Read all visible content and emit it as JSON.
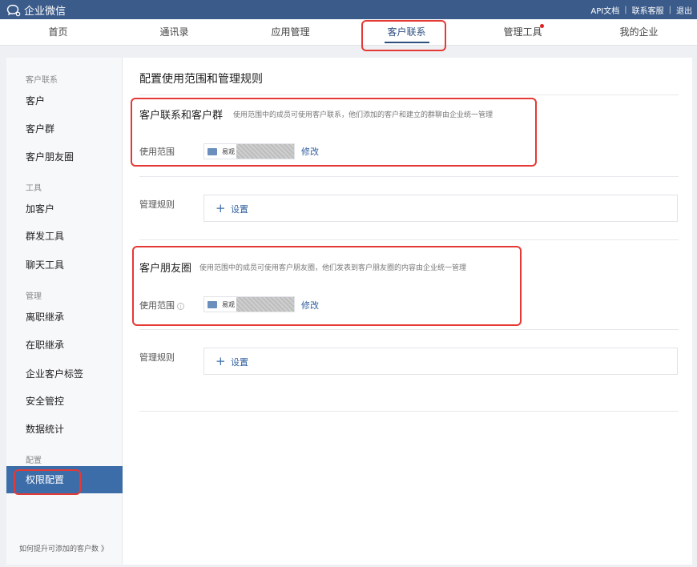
{
  "topbar": {
    "brand": "企业微信",
    "links": [
      "API文档",
      "联系客服",
      "退出"
    ]
  },
  "nav": {
    "items": [
      "首页",
      "通讯录",
      "应用管理",
      "客户联系",
      "管理工具",
      "我的企业"
    ],
    "active_index": 3,
    "notification_on": "管理工具"
  },
  "sidebar": {
    "groups": [
      {
        "title": "客户联系",
        "items": [
          "客户",
          "客户群",
          "客户朋友圈"
        ]
      },
      {
        "title": "工具",
        "items": [
          "加客户",
          "群发工具",
          "聊天工具"
        ]
      },
      {
        "title": "管理",
        "items": [
          "离职继承",
          "在职继承",
          "企业客户标签",
          "安全管控",
          "数据统计"
        ]
      },
      {
        "title": "配置",
        "items": [
          "权限配置"
        ]
      }
    ],
    "active_item": "权限配置",
    "footer": "如何提升可添加的客户数 》"
  },
  "content": {
    "title": "配置使用范围和管理规则",
    "sections": [
      {
        "title": "客户联系和客户群",
        "description": "使用范围中的成员可使用客户联系，他们添加的客户和建立的群聊由企业统一管理",
        "scope_label": "使用范围",
        "scope_value": "易观",
        "modify_label": "修改",
        "rule_label": "管理规则",
        "rule_action": "设置"
      },
      {
        "title": "客户朋友圈",
        "description": "使用范围中的成员可使用客户朋友圈，他们发表到客户朋友圈的内容由企业统一管理",
        "scope_label": "使用范围",
        "scope_value": "易观",
        "modify_label": "修改",
        "rule_label": "管理规则",
        "rule_action": "设置"
      }
    ]
  },
  "colors": {
    "topbar": "#3b5b8a",
    "accent": "#3d6da8",
    "highlight": "#e53935"
  }
}
